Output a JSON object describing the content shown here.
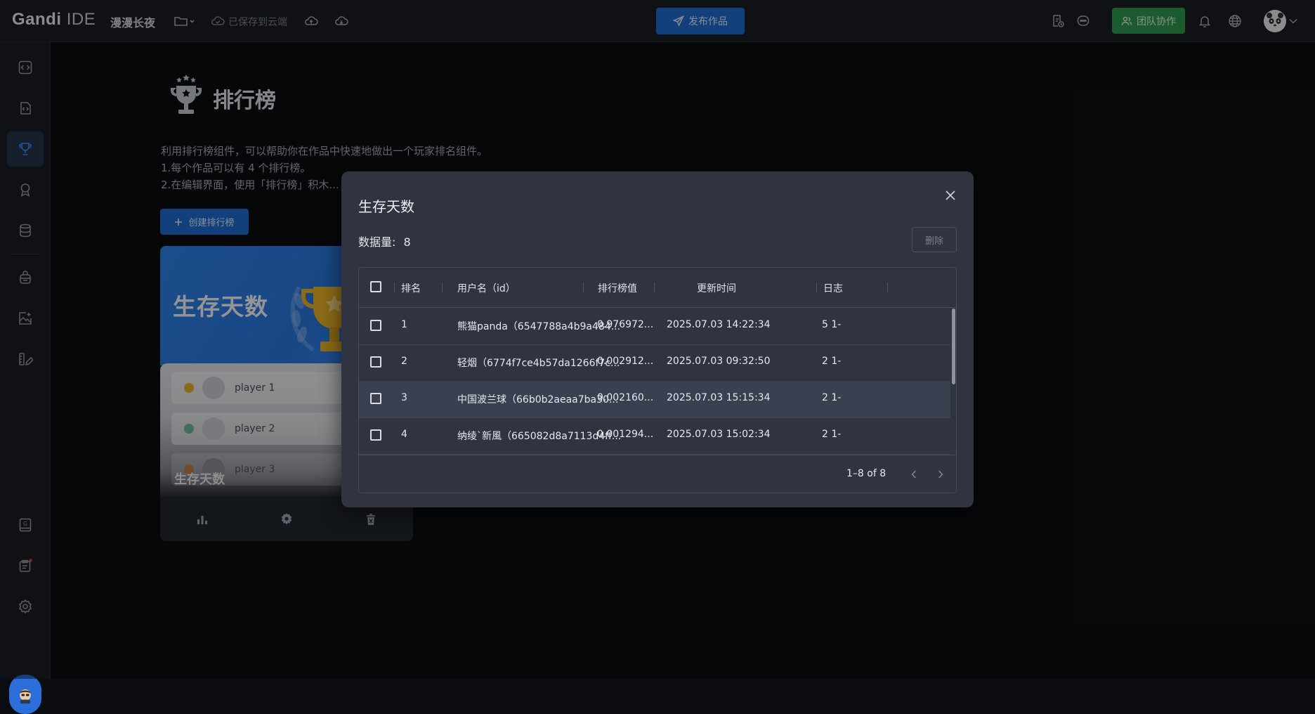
{
  "app": {
    "brand_bold": "Gandi",
    "brand_light": "IDE",
    "project_name": "漫漫长夜",
    "saved_status": "已保存到云端"
  },
  "topbar": {
    "publish_label": "发布作品",
    "team_label": "团队协作"
  },
  "leaderboard_page": {
    "title": "排行榜",
    "description": [
      "利用排行榜组件，可以帮助你在作品中快速地做出一个玩家排名组件。",
      "1.每个作品可以有 4 个排行榜。",
      "2.在编辑界面，使用「排行榜」积木..."
    ],
    "create_label": "创建排行榜",
    "card": {
      "hero_title": "生存天数",
      "name": "生存天数",
      "players": [
        "player 1",
        "player 2",
        "player 3"
      ]
    }
  },
  "modal": {
    "title": "生存天数",
    "count_label": "数据量:",
    "count_value": "8",
    "delete_label": "删除",
    "columns": [
      "排名",
      "用户名（id）",
      "排行榜值",
      "更新时间",
      "日志"
    ],
    "rows": [
      {
        "rank": "1",
        "user": "熊猫panda（6547788a4b9a484...",
        "value": "0.976972...",
        "time": "2025.07.03 14:22:34",
        "log": "5 1-"
      },
      {
        "rank": "2",
        "user": "轻烟（6774f7ce4b57da1266f7c...",
        "value": "0.002912...",
        "time": "2025.07.03 09:32:50",
        "log": "2 1-"
      },
      {
        "rank": "3",
        "user": "中国波兰球（66b0b2aeaa7ba30...",
        "value": "0.002160...",
        "time": "2025.07.03 15:15:34",
        "log": "2 1-"
      },
      {
        "rank": "4",
        "user": "纳绫`新風（665082d8a7113d4ff...",
        "value": "0.001294...",
        "time": "2025.07.03 15:02:34",
        "log": "2 1-"
      }
    ],
    "pagination": "1–8 of 8"
  },
  "colors": {
    "accent": "#1f6ed8",
    "team": "#2f9e52",
    "modal_bg": "#2f3440",
    "page_bg": "#0b0d11"
  }
}
